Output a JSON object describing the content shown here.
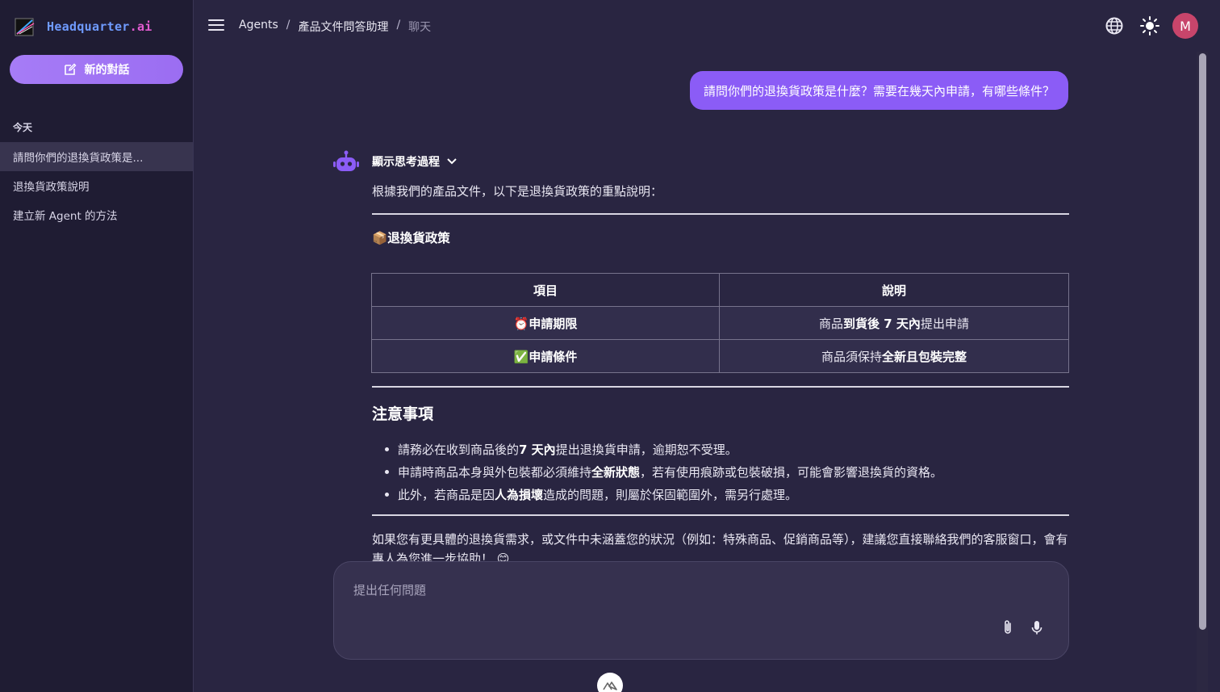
{
  "brand": {
    "name_main": "Headquarter",
    "name_suffix": ".ai"
  },
  "sidebar": {
    "new_chat_label": "新的對話",
    "section_today": "今天",
    "items": [
      {
        "label": "請問你們的退換貨政策是..."
      },
      {
        "label": "退換貨政策說明"
      },
      {
        "label": "建立新 Agent 的方法"
      }
    ]
  },
  "header": {
    "breadcrumb": [
      "Agents",
      "產品文件問答助理",
      "聊天"
    ],
    "separator": "/",
    "avatar_initial": "M",
    "icons": [
      "menu-icon",
      "globe-icon",
      "sun-icon"
    ]
  },
  "chat": {
    "user_message": "請問你們的退換貨政策是什麼？需要在幾天內申請，有哪些條件？",
    "thinking_toggle": "顯示思考過程",
    "intro": "根據我們的產品文件，以下是退換貨政策的重點說明：",
    "policy_heading": "📦退換貨政策",
    "table": {
      "headers": [
        "項目",
        "說明"
      ],
      "rows": [
        {
          "item": "⏰申請期限",
          "desc_pre": "商品",
          "desc_bold": "到貨後 7 天內",
          "desc_post": "提出申請"
        },
        {
          "item": "✅申請條件",
          "desc_pre": "商品須保持",
          "desc_bold": "全新且包裝完整",
          "desc_post": ""
        }
      ]
    },
    "notes_heading": "注意事項",
    "notes": [
      {
        "pre": "請務必在收到商品後的 ",
        "bold": "7 天內",
        "post": "提出退換貨申請，逾期恕不受理。"
      },
      {
        "pre": "申請時商品本身與外包裝都必須維持",
        "bold": "全新狀態",
        "post": "，若有使用痕跡或包裝破損，可能會影響退換貨的資格。"
      },
      {
        "pre": "此外，若商品是因",
        "bold": "人為損壞",
        "post": "造成的問題，則屬於保固範圍外，需另行處理。"
      }
    ],
    "closing": "如果您有更具體的退換貨需求，或文件中未涵蓋您的狀況（例如：特殊商品、促銷商品等），建議您直接聯絡我們的客服窗口，會有專人為您進一步協助！ 😊"
  },
  "composer": {
    "placeholder": "提出任何問題",
    "icons": [
      "paperclip-icon",
      "microphone-icon"
    ]
  },
  "colors": {
    "accent": "#8b5cf6",
    "background": "#292541",
    "sidebar": "#1f1c33",
    "avatar": "#c8456b"
  }
}
